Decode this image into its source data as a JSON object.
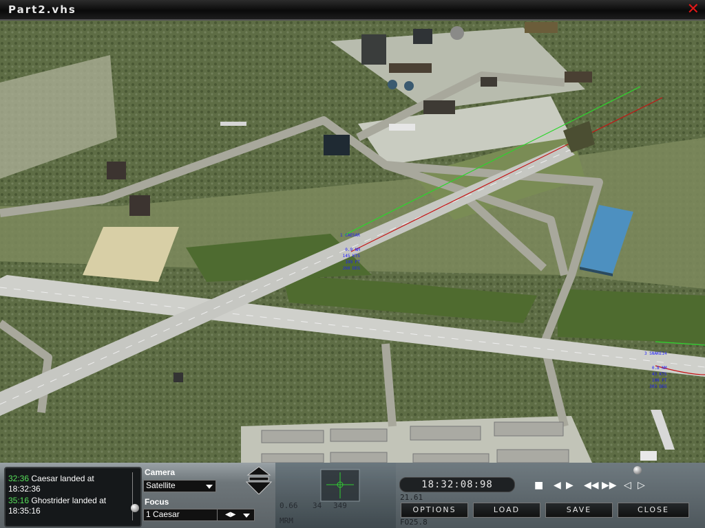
{
  "window": {
    "title": "Part2.vhs",
    "close_glyph": "✕"
  },
  "hud": [
    {
      "name": "1 CAESAR",
      "lines": [
        "0.9 NM",
        "145 KTS",
        "199 FT",
        "260 DEG"
      ]
    },
    {
      "name": "3 SNAKE14",
      "lines": [
        "0.8 NM",
        "43 KTS",
        "199 FT",
        "303 DEG"
      ]
    }
  ],
  "log": [
    {
      "time": "32:36",
      "text": "Caesar landed at",
      "text2": "18:32:36"
    },
    {
      "time": "35:16",
      "text": "Ghostrider landed at",
      "text2": "18:35:16"
    }
  ],
  "camera": {
    "label": "Camera",
    "value": "Satellite"
  },
  "focus": {
    "label": "Focus",
    "value": "1 Caesar"
  },
  "clock": "18:32:08:98",
  "transport": {
    "stop": "■",
    "step_back": "◀",
    "step_fwd": "▶",
    "rewind": "◀◀",
    "ffwd": "▶▶",
    "slow_back": "◁",
    "slow_fwd": "▷"
  },
  "buttons": {
    "options": "OPTIONS",
    "load": "LOAD",
    "save": "SAVE",
    "close": "CLOSE"
  },
  "cockpit_readouts": [
    "21.61",
    "0.66",
    "349",
    "34",
    "MRM",
    "FO25.8"
  ],
  "colors": {
    "path_green": "#2bd62b",
    "path_red": "#c41414",
    "hud_blue": "#1d1dff",
    "log_time": "#57e05a",
    "close_red": "#e01818"
  }
}
